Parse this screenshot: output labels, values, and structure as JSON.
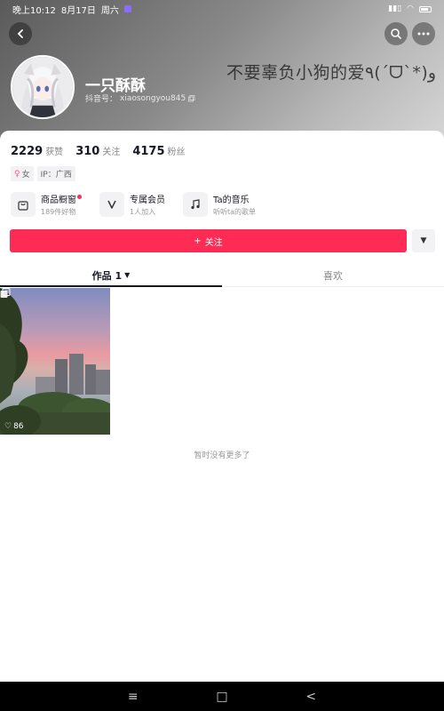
{
  "status_bar": {
    "time": "晚上10:12",
    "date": "8月17日",
    "weekday": "周六",
    "battery": "battery-icon",
    "wifi": "wifi-icon"
  },
  "header": {
    "back_icon": "back-arrow-icon",
    "search_icon": "search-icon",
    "more_icon": "more-icon",
    "signature": "不要辜负小狗的爱٩(ˊᗜˋ*)و"
  },
  "profile": {
    "nickname": "一只酥酥",
    "douyin_id_label": "抖音号：",
    "douyin_id": "xiaosongyou845",
    "copy_icon": "copy-icon"
  },
  "stats": [
    {
      "value": "2229",
      "label": "获赞"
    },
    {
      "value": "310",
      "label": "关注"
    },
    {
      "value": "4175",
      "label": "粉丝"
    }
  ],
  "tags": {
    "gender": "女",
    "ip": "IP：广西"
  },
  "services": [
    {
      "icon": "shopping-bag-icon",
      "title": "商品橱窗",
      "subtitle": "189件好物",
      "has_dot": true
    },
    {
      "icon": "v-badge-icon",
      "title": "专属会员",
      "subtitle": "1人加入",
      "has_dot": false
    },
    {
      "icon": "music-note-icon",
      "title": "Ta的音乐",
      "subtitle": "听听ta的歌单",
      "has_dot": false
    }
  ],
  "follow_button": "关注",
  "tabs": {
    "works": "作品 1",
    "likes": "喜欢"
  },
  "post": {
    "like_count": "86"
  },
  "no_more_text": "暂时没有更多了",
  "nav": {
    "menu": "≡",
    "home": "□",
    "back": "<"
  }
}
